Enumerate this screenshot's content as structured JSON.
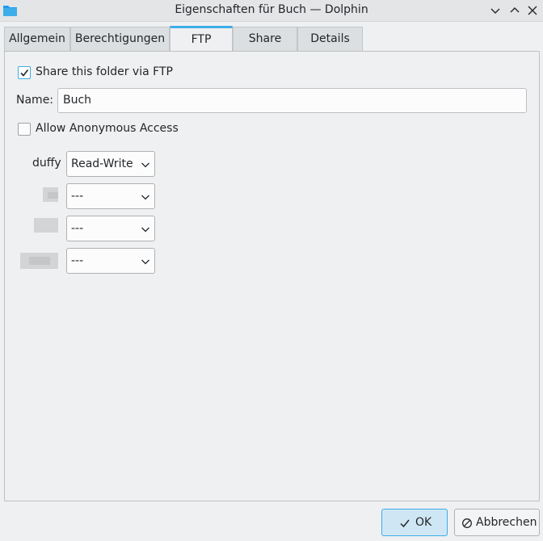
{
  "window": {
    "title": "Eigenschaften für Buch — Dolphin",
    "app_icon": "folder-icon",
    "controls": [
      "minimize-icon",
      "maximize-icon",
      "close-icon"
    ]
  },
  "tabs": [
    {
      "label": "Allgemein",
      "active": false
    },
    {
      "label": "Berechtigungen",
      "active": false
    },
    {
      "label": "FTP",
      "active": true
    },
    {
      "label": "Share",
      "active": false
    },
    {
      "label": "Details",
      "active": false
    }
  ],
  "ftp": {
    "share_checkbox": {
      "label": "Share this folder via FTP",
      "checked": true
    },
    "name": {
      "label": "Name:",
      "value": "Buch"
    },
    "anonymous_checkbox": {
      "label": "Allow Anonymous Access",
      "checked": false
    },
    "users": [
      {
        "name": "duffy",
        "permission": "Read-Write"
      },
      {
        "name": "",
        "permission": "---"
      },
      {
        "name": "",
        "permission": "---"
      },
      {
        "name": "",
        "permission": "---"
      }
    ]
  },
  "buttons": {
    "ok": {
      "label": "OK",
      "icon": "checkmark-icon"
    },
    "cancel": {
      "label": "Abbrechen",
      "icon": "cancel-icon"
    }
  },
  "colors": {
    "accent": "#3daee9",
    "background": "#eff0f1"
  }
}
